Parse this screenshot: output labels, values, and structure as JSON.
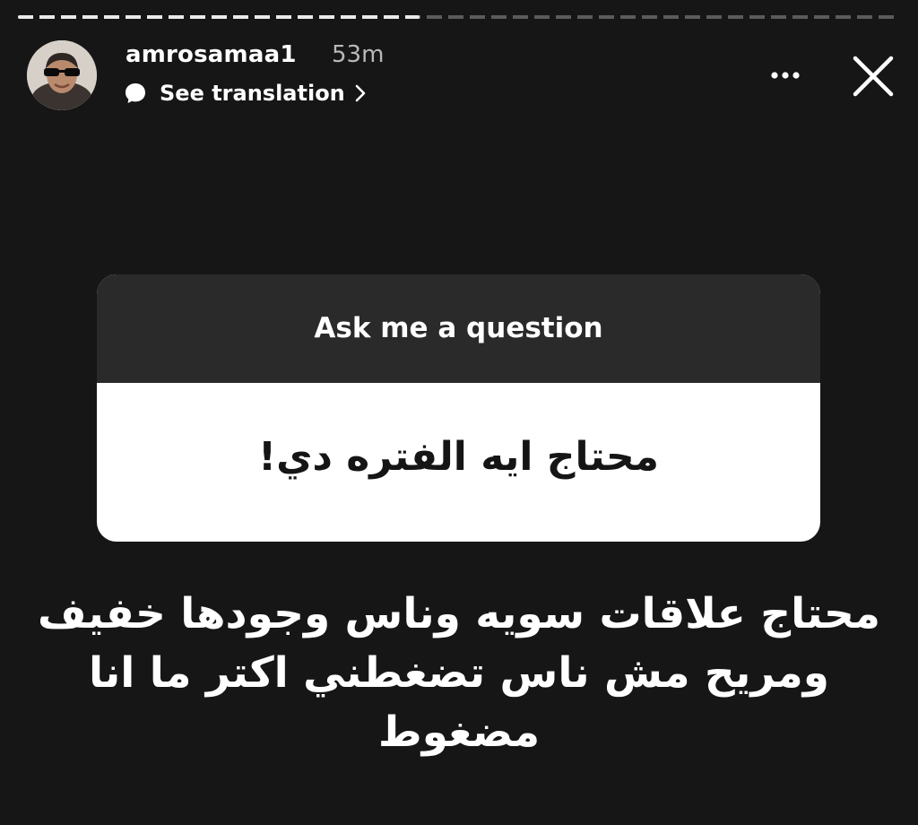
{
  "story": {
    "progress_fraction": 0.455
  },
  "header": {
    "username": "amrosamaa1",
    "timestamp": "53m",
    "translate_label": "See translation",
    "avatar_icon": "profile-photo-with-sunglasses",
    "more_icon": "ellipsis-icon",
    "close_icon": "close-icon"
  },
  "question_sticker": {
    "title": "Ask me a question",
    "question": "محتاج ايه الفتره دي!"
  },
  "reply": {
    "line1": "محتاج علاقات سويه وناس وجودها خفيف",
    "line2": "ومريح مش ناس تضغطني اكتر ما انا مضغوط"
  },
  "colors": {
    "background": "#171616",
    "sticker_header": "#2a2a2a",
    "sticker_body": "#ffffff",
    "progress_active": "#e9e9e9",
    "progress_inactive": "#5b5b5b"
  }
}
